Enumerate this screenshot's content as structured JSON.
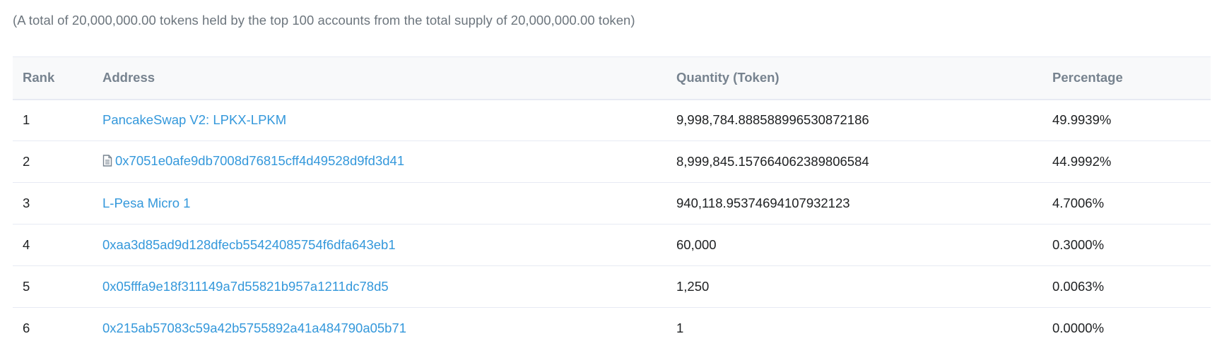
{
  "summary": "(A total of 20,000,000.00 tokens held by the top 100 accounts from the total supply of 20,000,000.00 token)",
  "table": {
    "headers": {
      "rank": "Rank",
      "address": "Address",
      "quantity": "Quantity (Token)",
      "percentage": "Percentage"
    },
    "rows": [
      {
        "rank": "1",
        "address": "PancakeSwap V2: LPKX-LPKM",
        "is_contract": false,
        "quantity": "9,998,784.888588996530872186",
        "percentage": "49.9939%"
      },
      {
        "rank": "2",
        "address": "0x7051e0afe9db7008d76815cff4d49528d9fd3d41",
        "is_contract": true,
        "quantity": "8,999,845.157664062389806584",
        "percentage": "44.9992%"
      },
      {
        "rank": "3",
        "address": "L-Pesa Micro 1",
        "is_contract": false,
        "quantity": "940,118.95374694107932123",
        "percentage": "4.7006%"
      },
      {
        "rank": "4",
        "address": "0xaa3d85ad9d128dfecb55424085754f6dfa643eb1",
        "is_contract": false,
        "quantity": "60,000",
        "percentage": "0.3000%"
      },
      {
        "rank": "5",
        "address": "0x05fffa9e18f311149a7d55821b957a1211dc78d5",
        "is_contract": false,
        "quantity": "1,250",
        "percentage": "0.0063%"
      },
      {
        "rank": "6",
        "address": "0x215ab57083c59a42b5755892a41a484790a05b71",
        "is_contract": false,
        "quantity": "1",
        "percentage": "0.0000%"
      }
    ]
  },
  "colors": {
    "link": "#3498db",
    "muted": "#6c757d",
    "header_text": "#77838f",
    "border": "#e7eaf3"
  },
  "icons": {
    "contract": "contract-file-icon"
  }
}
